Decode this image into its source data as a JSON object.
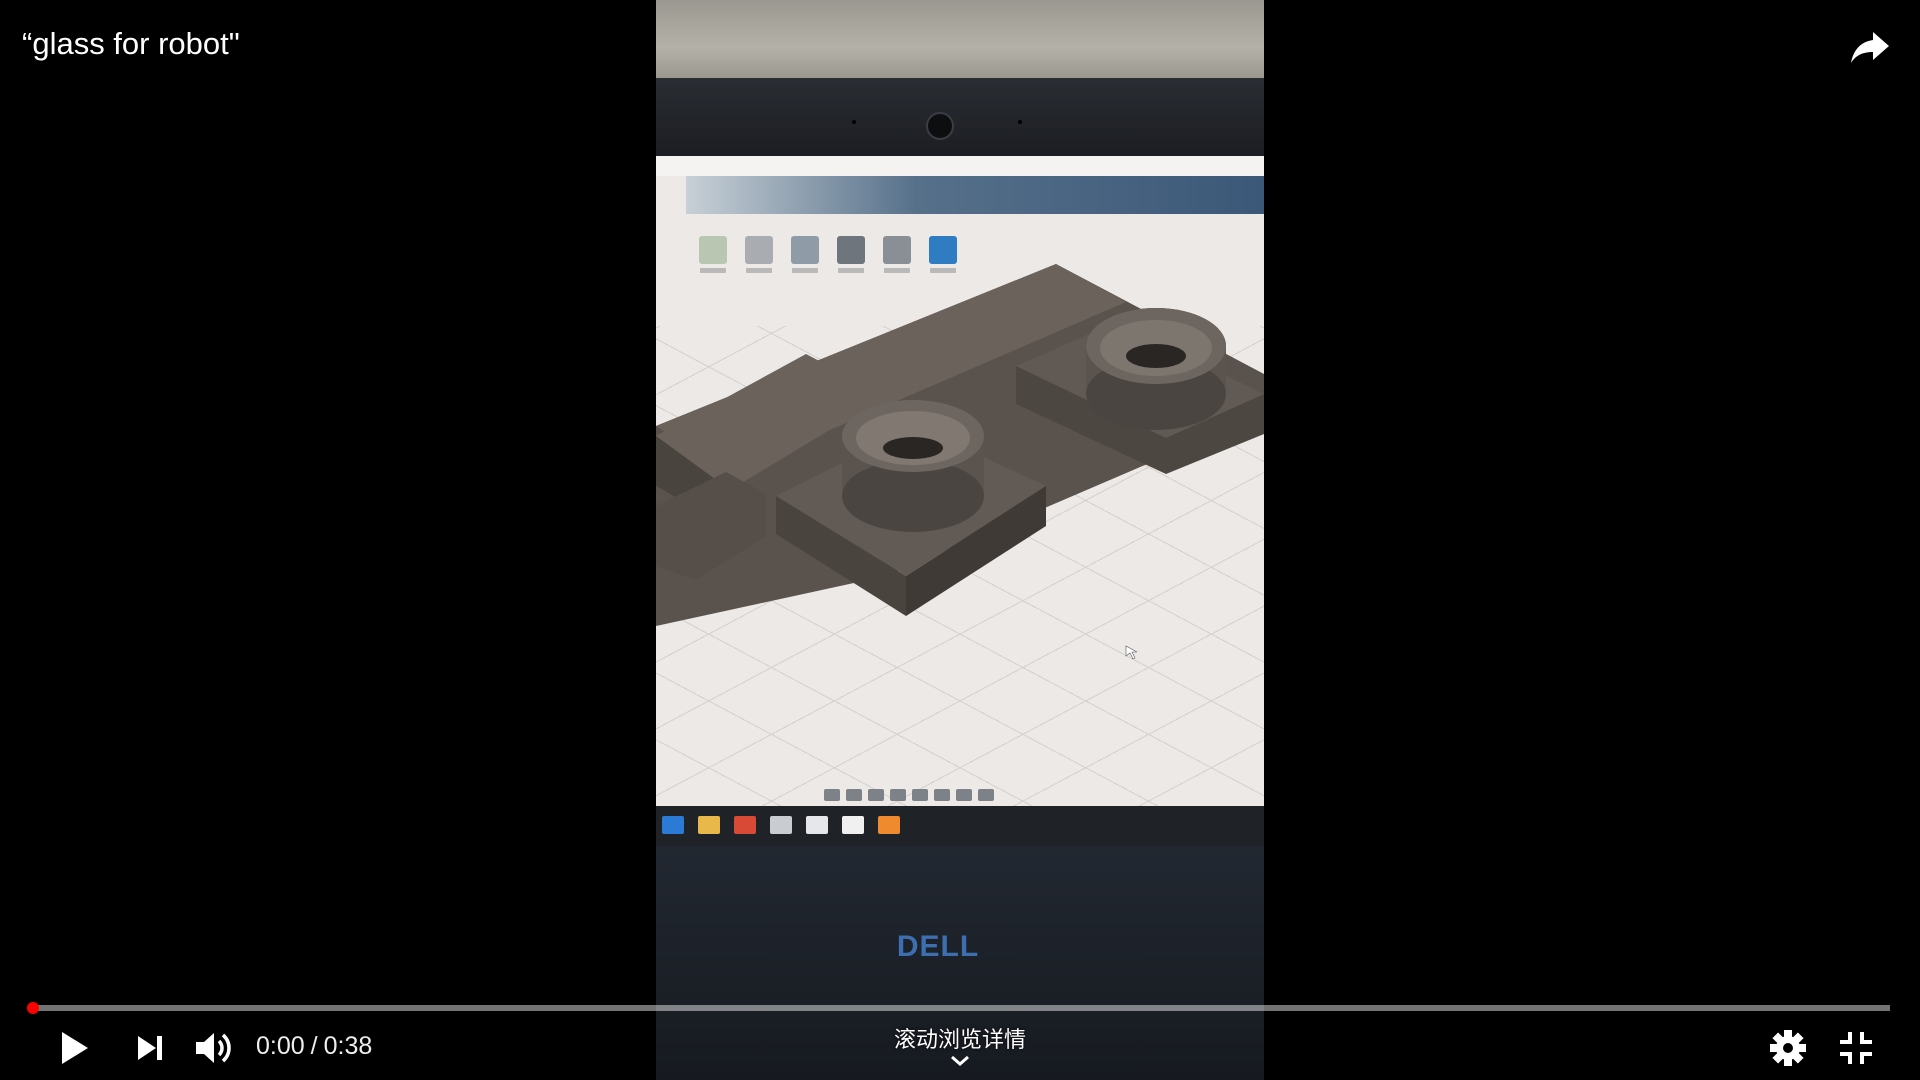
{
  "video": {
    "title": "“glass for robot\"",
    "current_time": "0:00",
    "time_separator": "/",
    "duration": "0:38",
    "progress": 0.0,
    "scroll_hint": "滚动浏览详情",
    "brand_logo": "DELL"
  },
  "controls": {
    "play": "play-icon",
    "next": "next-icon",
    "volume": "volume-icon",
    "settings": "gear-icon",
    "exit_fullscreen": "exit-fullscreen-icon",
    "share": "share-icon"
  },
  "colors": {
    "progress_played": "#ff0000",
    "background": "#000000",
    "model_dark": "#4e4843"
  }
}
